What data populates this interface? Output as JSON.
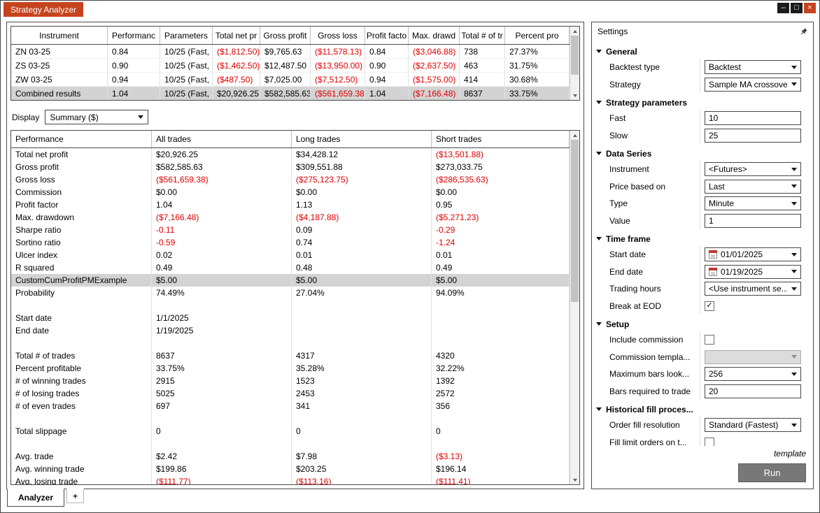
{
  "window": {
    "title": "Strategy Analyzer",
    "controls": {
      "minimize": "–",
      "maximize": "□",
      "close": "×"
    }
  },
  "results_table": {
    "columns": [
      "Instrument",
      "Performanc",
      "Parameters",
      "Total net pr",
      "Gross profit",
      "Gross loss",
      "Profit facto",
      "Max. drawd",
      "Total # of tr",
      "Percent pro"
    ],
    "rows": [
      {
        "cells": [
          "ZN 03-25",
          "0.84",
          "10/25 (Fast,",
          "($1,812.50)",
          "$9,765.63",
          "($11,578.13)",
          "0.84",
          "($3,046.88)",
          "738",
          "27.37%"
        ],
        "highlighted": false
      },
      {
        "cells": [
          "ZS 03-25",
          "0.90",
          "10/25 (Fast,",
          "($1,462.50)",
          "$12,487.50",
          "($13,950.00)",
          "0.90",
          "($2,637.50)",
          "463",
          "31.75%"
        ],
        "highlighted": false
      },
      {
        "cells": [
          "ZW 03-25",
          "0.94",
          "10/25 (Fast,",
          "($487.50)",
          "$7,025.00",
          "($7,512.50)",
          "0.94",
          "($1,575.00)",
          "414",
          "30.68%"
        ],
        "highlighted": false
      },
      {
        "cells": [
          "Combined results",
          "1.04",
          "10/25 (Fast,",
          "$20,926.25",
          "$582,585.63",
          "($561,659.38)",
          "1.04",
          "($7,166.48)",
          "8637",
          "33.75%"
        ],
        "highlighted": true
      }
    ]
  },
  "display": {
    "label": "Display",
    "value": "Summary ($)"
  },
  "performance_table": {
    "columns": [
      "Performance",
      "All trades",
      "Long trades",
      "Short trades"
    ],
    "rows": [
      {
        "cells": [
          "Total net profit",
          "$20,926.25",
          "$34,428.12",
          "($13,501.88)"
        ]
      },
      {
        "cells": [
          "Gross profit",
          "$582,585.63",
          "$309,551.88",
          "$273,033.75"
        ]
      },
      {
        "cells": [
          "Gross loss",
          "($561,659.38)",
          "($275,123.75)",
          "($286,535.63)"
        ]
      },
      {
        "cells": [
          "Commission",
          "$0.00",
          "$0.00",
          "$0.00"
        ]
      },
      {
        "cells": [
          "Profit factor",
          "1.04",
          "1.13",
          "0.95"
        ]
      },
      {
        "cells": [
          "Max. drawdown",
          "($7,166.48)",
          "($4,187.88)",
          "($5,271.23)"
        ]
      },
      {
        "cells": [
          "Sharpe ratio",
          "-0.11",
          "0.09",
          "-0.29"
        ]
      },
      {
        "cells": [
          "Sortino ratio",
          "-0.59",
          "0.74",
          "-1.24"
        ]
      },
      {
        "cells": [
          "Ulcer index",
          "0.02",
          "0.01",
          "0.01"
        ]
      },
      {
        "cells": [
          "R squared",
          "0.49",
          "0.48",
          "0.49"
        ]
      },
      {
        "cells": [
          "CustomCumProfitPMExample",
          "$5.00",
          "$5.00",
          "$5.00"
        ],
        "highlighted": true
      },
      {
        "cells": [
          "Probability",
          "74.49%",
          "27.04%",
          "94.09%"
        ]
      },
      {
        "cells": [
          "",
          "",
          "",
          ""
        ]
      },
      {
        "cells": [
          "Start date",
          "1/1/2025",
          "",
          ""
        ]
      },
      {
        "cells": [
          "End date",
          "1/19/2025",
          "",
          ""
        ]
      },
      {
        "cells": [
          "",
          "",
          "",
          ""
        ]
      },
      {
        "cells": [
          "Total # of trades",
          "8637",
          "4317",
          "4320"
        ]
      },
      {
        "cells": [
          "Percent profitable",
          "33.75%",
          "35.28%",
          "32.22%"
        ]
      },
      {
        "cells": [
          "# of winning trades",
          "2915",
          "1523",
          "1392"
        ]
      },
      {
        "cells": [
          "# of losing trades",
          "5025",
          "2453",
          "2572"
        ]
      },
      {
        "cells": [
          "# of even trades",
          "697",
          "341",
          "356"
        ]
      },
      {
        "cells": [
          "",
          "",
          "",
          ""
        ]
      },
      {
        "cells": [
          "Total slippage",
          "0",
          "0",
          "0"
        ]
      },
      {
        "cells": [
          "",
          "",
          "",
          ""
        ]
      },
      {
        "cells": [
          "Avg. trade",
          "$2.42",
          "$7.98",
          "($3.13)"
        ]
      },
      {
        "cells": [
          "Avg. winning trade",
          "$199.86",
          "$203.25",
          "$196.14"
        ]
      },
      {
        "cells": [
          "Avg. losing trade",
          "($111.77)",
          "($113.16)",
          "($111.41)"
        ]
      }
    ]
  },
  "settings": {
    "title": "Settings",
    "sections": [
      {
        "label": "General",
        "fields": [
          {
            "name": "backtest-type",
            "label": "Backtest type",
            "type": "dropdown",
            "value": "Backtest"
          },
          {
            "name": "strategy",
            "label": "Strategy",
            "type": "dropdown",
            "value": "Sample MA crossover"
          }
        ]
      },
      {
        "label": "Strategy parameters",
        "fields": [
          {
            "name": "fast",
            "label": "Fast",
            "type": "input",
            "value": "10"
          },
          {
            "name": "slow",
            "label": "Slow",
            "type": "input",
            "value": "25"
          }
        ]
      },
      {
        "label": "Data Series",
        "fields": [
          {
            "name": "instrument",
            "label": "Instrument",
            "type": "dropdown",
            "value": "<Futures>"
          },
          {
            "name": "price-based-on",
            "label": "Price based on",
            "type": "dropdown",
            "value": "Last"
          },
          {
            "name": "type",
            "label": "Type",
            "type": "dropdown",
            "value": "Minute"
          },
          {
            "name": "value",
            "label": "Value",
            "type": "input",
            "value": "1"
          }
        ]
      },
      {
        "label": "Time frame",
        "fields": [
          {
            "name": "start-date",
            "label": "Start date",
            "type": "date",
            "value": "01/01/2025"
          },
          {
            "name": "end-date",
            "label": "End date",
            "type": "date",
            "value": "01/19/2025"
          },
          {
            "name": "trading-hours",
            "label": "Trading hours",
            "type": "dropdown",
            "value": "<Use instrument se..."
          },
          {
            "name": "break-at-eod",
            "label": "Break at EOD",
            "type": "checkbox",
            "checked": true
          }
        ]
      },
      {
        "label": "Setup",
        "fields": [
          {
            "name": "include-commission",
            "label": "Include commission",
            "type": "checkbox",
            "checked": false
          },
          {
            "name": "commission-template",
            "label": "Commission templa...",
            "type": "dropdown",
            "value": "",
            "disabled": true
          },
          {
            "name": "maximum-bars-lookback",
            "label": "Maximum bars look...",
            "type": "dropdown",
            "value": "256"
          },
          {
            "name": "bars-required-to-trade",
            "label": "Bars required to trade",
            "type": "input",
            "value": "20"
          }
        ]
      },
      {
        "label": "Historical fill proces...",
        "fields": [
          {
            "name": "order-fill-resolution",
            "label": "Order fill resolution",
            "type": "dropdown",
            "value": "Standard (Fastest)"
          },
          {
            "name": "fill-limit-orders",
            "label": "Fill limit orders on t...",
            "type": "checkbox",
            "checked": false
          }
        ]
      }
    ],
    "footer_link": "template",
    "run_label": "Run"
  },
  "tabs": {
    "analyzer": "Analyzer",
    "add": "+"
  }
}
